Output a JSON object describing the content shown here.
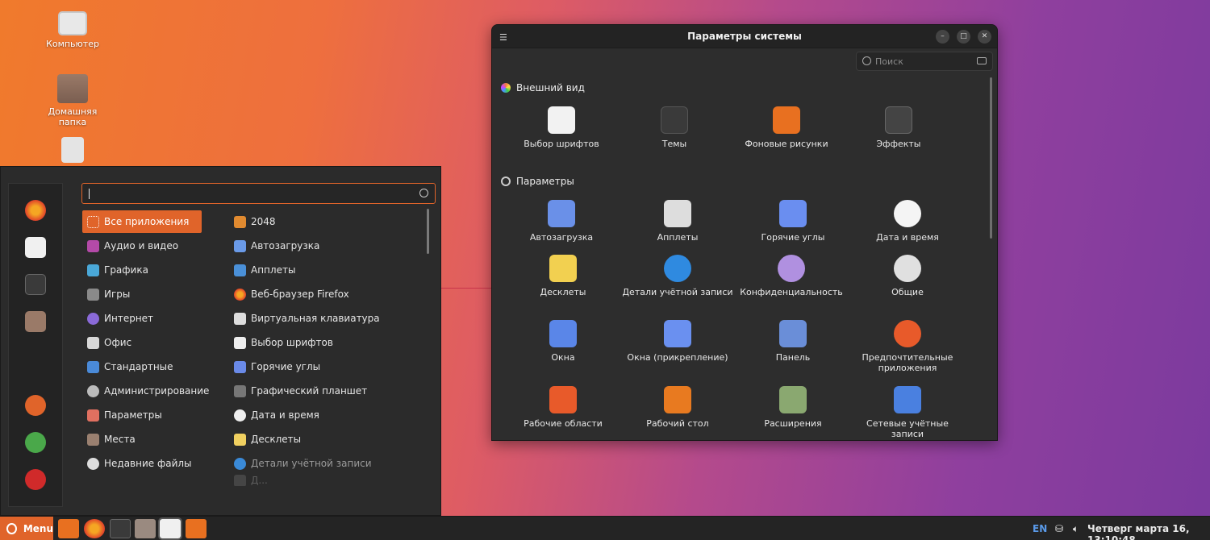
{
  "desktop": {
    "icons": [
      {
        "label": "Компьютер",
        "icon": "computer-icon"
      },
      {
        "label": "Домашняя папка",
        "icon": "home-folder-icon"
      },
      {
        "label": "",
        "icon": "trash-icon"
      }
    ]
  },
  "menu": {
    "search_value": "",
    "favorites": [
      "firefox-icon",
      "settings-icon",
      "terminal-icon",
      "files-icon",
      "lock-icon",
      "logout-icon",
      "power-icon"
    ],
    "categories": [
      {
        "label": "Все приложения",
        "icon": "grid-icon",
        "color": "#e0642a"
      },
      {
        "label": "Аудио и видео",
        "icon": "media-icon",
        "color": "#b44aa8"
      },
      {
        "label": "Графика",
        "icon": "graphics-icon",
        "color": "#4aa8d8"
      },
      {
        "label": "Игры",
        "icon": "gamepad-icon",
        "color": "#8a8a8a"
      },
      {
        "label": "Интернет",
        "icon": "internet-icon",
        "color": "#8a6ad8"
      },
      {
        "label": "Офис",
        "icon": "office-icon",
        "color": "#d8d8d8"
      },
      {
        "label": "Стандартные",
        "icon": "accessories-icon",
        "color": "#4a8ad8"
      },
      {
        "label": "Администрирование",
        "icon": "admin-icon",
        "color": "#bbbbbb"
      },
      {
        "label": "Параметры",
        "icon": "settings-icon",
        "color": "#e07060"
      },
      {
        "label": "Места",
        "icon": "places-icon",
        "color": "#9a8070"
      },
      {
        "label": "Недавние файлы",
        "icon": "clock-icon",
        "color": "#dddddd"
      }
    ],
    "apps": [
      {
        "label": "2048",
        "icon": "game-2048-icon",
        "color": "#e08a30"
      },
      {
        "label": "Автозагрузка",
        "icon": "autostart-icon",
        "color": "#6a9ae8"
      },
      {
        "label": "Апплеты",
        "icon": "applets-icon",
        "color": "#4a90d8"
      },
      {
        "label": "Веб-браузер Firefox",
        "icon": "firefox-icon",
        "color": "#e0642a"
      },
      {
        "label": "Виртуальная клавиатура",
        "icon": "keyboard-icon",
        "color": "#dddddd"
      },
      {
        "label": "Выбор шрифтов",
        "icon": "fonts-icon",
        "color": "#eeeeee"
      },
      {
        "label": "Горячие углы",
        "icon": "hot-corners-icon",
        "color": "#6a8ae8"
      },
      {
        "label": "Графический планшет",
        "icon": "tablet-icon",
        "color": "#777777"
      },
      {
        "label": "Дата и время",
        "icon": "clock-icon",
        "color": "#eeeeee"
      },
      {
        "label": "Десклеты",
        "icon": "desklets-icon",
        "color": "#f0d060"
      },
      {
        "label": "Детали учётной записи",
        "icon": "account-icon",
        "color": "#3a8ad8"
      },
      {
        "label": "Д...",
        "icon": "display-icon",
        "color": "#666666"
      }
    ]
  },
  "settings": {
    "title": "Параметры системы",
    "search_placeholder": "Поиск",
    "sections": [
      {
        "title": "Внешний вид",
        "items": [
          {
            "label": "Выбор шрифтов",
            "icon": "fonts-icon",
            "color": "#f2f2f2"
          },
          {
            "label": "Темы",
            "icon": "themes-icon",
            "color": "#3a3a3a"
          },
          {
            "label": "Фоновые рисунки",
            "icon": "wallpaper-icon",
            "color": "#e87020"
          },
          {
            "label": "Эффекты",
            "icon": "effects-icon",
            "color": "#444444"
          }
        ]
      },
      {
        "title": "Параметры",
        "items": [
          {
            "label": "Автозагрузка",
            "icon": "autostart-icon",
            "color": "#6a90e8"
          },
          {
            "label": "Апплеты",
            "icon": "applets-icon",
            "color": "#dddddd"
          },
          {
            "label": "Горячие углы",
            "icon": "hot-corners-icon",
            "color": "#6a8ef0"
          },
          {
            "label": "Дата и время",
            "icon": "clock-icon",
            "color": "#f4f4f4"
          },
          {
            "label": "Десклеты",
            "icon": "desklets-icon",
            "color": "#f2d050"
          },
          {
            "label": "Детали учётной записи",
            "icon": "account-icon",
            "color": "#2f8ae0"
          },
          {
            "label": "Конфиденциальность",
            "icon": "privacy-icon",
            "color": "#b090e0"
          },
          {
            "label": "Общие",
            "icon": "general-icon",
            "color": "#e0e0e0"
          },
          {
            "label": "Окна",
            "icon": "windows-icon",
            "color": "#5a86e8"
          },
          {
            "label": "Окна (прикрепление)",
            "icon": "windows-tiling-icon",
            "color": "#6a90f0"
          },
          {
            "label": "Панель",
            "icon": "panel-icon",
            "color": "#6a8ed8"
          },
          {
            "label": "Предпочтительные приложения",
            "icon": "preferred-apps-icon",
            "color": "#e85a2a"
          },
          {
            "label": "Рабочие области",
            "icon": "workspaces-icon",
            "color": "#e85a2a"
          },
          {
            "label": "Рабочий стол",
            "icon": "desktop-icon",
            "color": "#e87a20"
          },
          {
            "label": "Расширения",
            "icon": "extensions-icon",
            "color": "#8aa870"
          },
          {
            "label": "Сетевые учётные записи",
            "icon": "online-accounts-icon",
            "color": "#4a80e0"
          }
        ]
      }
    ]
  },
  "panel": {
    "menu_label": "Menu",
    "launchers": [
      "desktop-icon",
      "firefox-icon",
      "terminal-icon",
      "files-icon",
      "settings-icon",
      "wallpaper-icon"
    ],
    "keyboard_layout": "EN",
    "clock": "Четверг марта 16, 13:10:48",
    "colors": {
      "accent": "#e0642a"
    }
  }
}
